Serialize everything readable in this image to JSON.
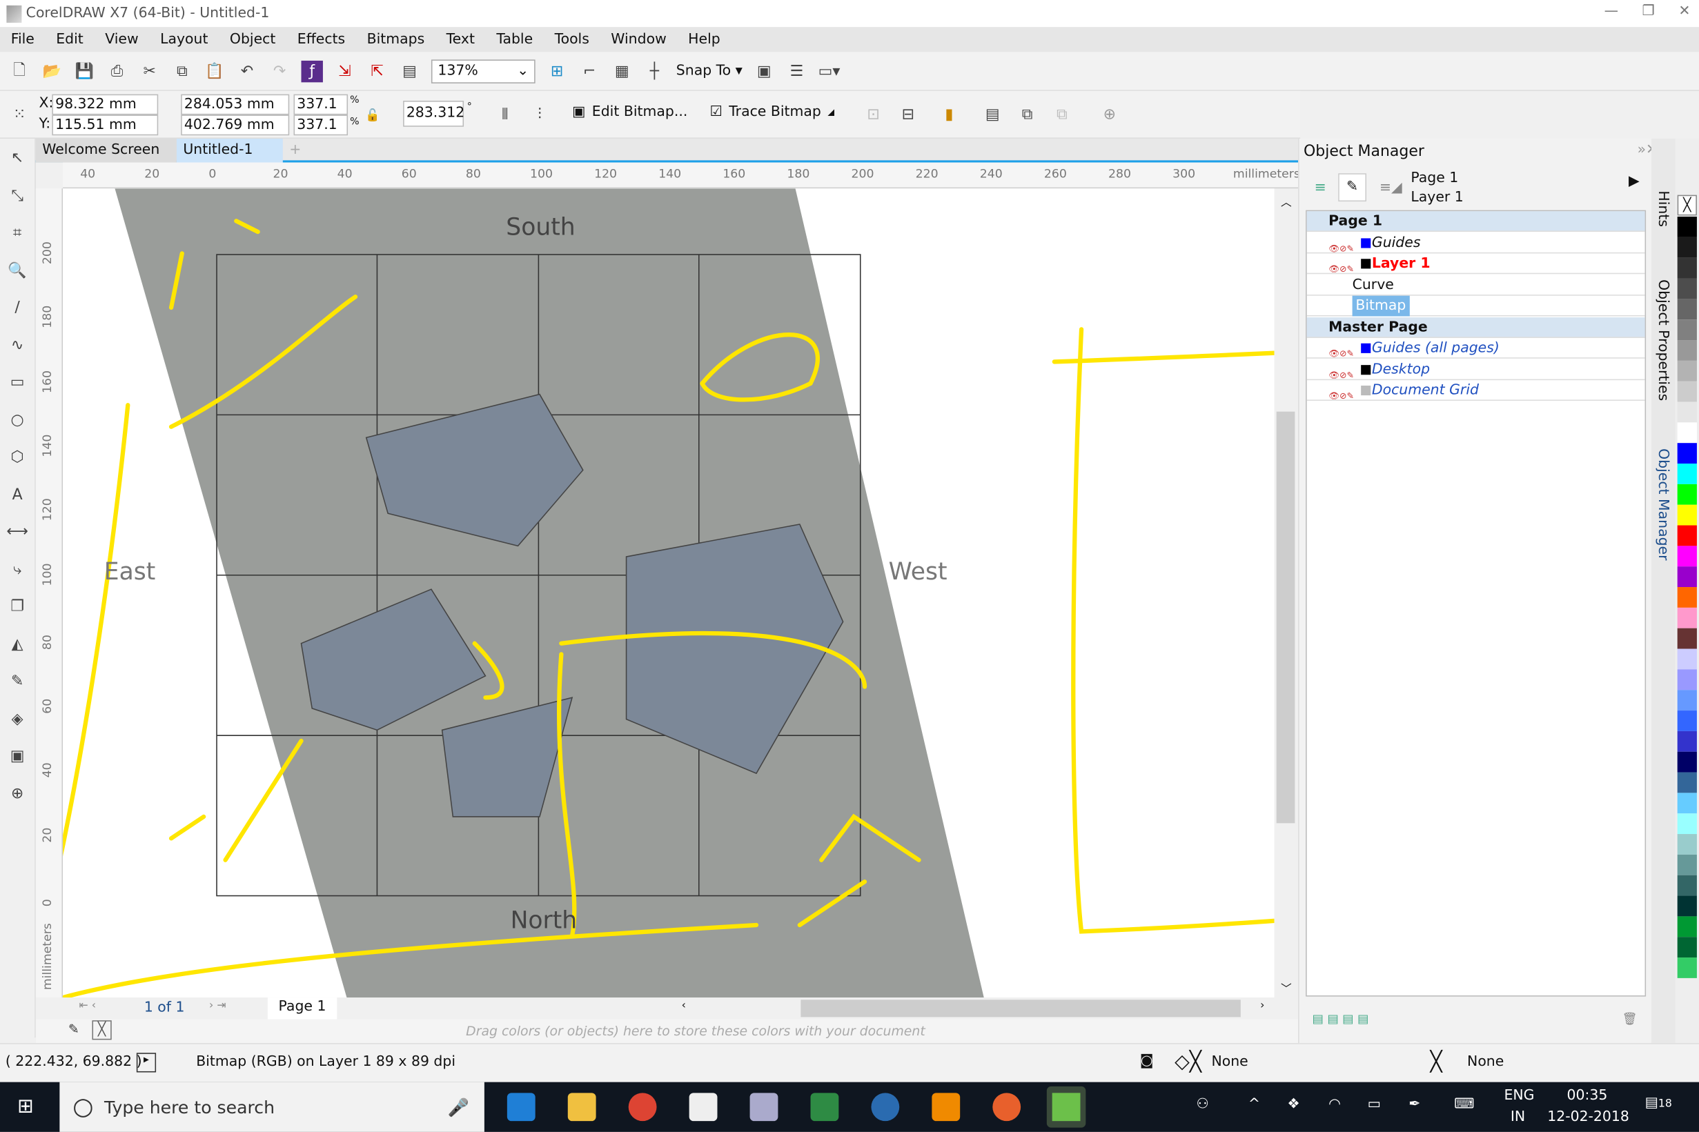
{
  "window": {
    "title": "CorelDRAW X7 (64-Bit) - Untitled-1"
  },
  "menu": [
    "File",
    "Edit",
    "View",
    "Layout",
    "Object",
    "Effects",
    "Bitmaps",
    "Text",
    "Table",
    "Tools",
    "Window",
    "Help"
  ],
  "toolbar": {
    "zoom": "137%",
    "snap_to": "Snap To"
  },
  "propbar": {
    "x": "98.322 mm",
    "y": "115.51 mm",
    "width": "284.053 mm",
    "height": "402.769 mm",
    "scale_x": "337.1",
    "scale_y": "337.1",
    "pct": "%",
    "angle": "283.312",
    "degree": "°",
    "edit_bitmap": "Edit Bitmap...",
    "trace_bitmap": "Trace Bitmap",
    "x_label": "X:",
    "y_label": "Y:"
  },
  "tabs": [
    "Welcome Screen",
    "Untitled-1"
  ],
  "ruler": {
    "h_ticks": [
      "40",
      "20",
      "0",
      "20",
      "40",
      "60",
      "80",
      "100",
      "120",
      "140",
      "160",
      "180",
      "200",
      "220",
      "240",
      "260",
      "280",
      "300"
    ],
    "h_unit": "millimeters",
    "v_ticks": [
      "200",
      "180",
      "160",
      "140",
      "120",
      "100",
      "80",
      "60",
      "40",
      "20",
      "0"
    ],
    "v_unit": "millimeters"
  },
  "canvas": {
    "labels": {
      "south": "South",
      "east": "East",
      "west": "West",
      "north": "North"
    }
  },
  "nav": {
    "page_count": "1 of 1",
    "page_tab": "Page 1"
  },
  "palette_hint": "Drag colors (or objects) here to store these colors with your document",
  "status": {
    "coords": "( 222.432, 69.882 )",
    "info": "Bitmap (RGB) on Layer 1 89 x 89 dpi",
    "fill": "None",
    "outline": "None"
  },
  "object_manager": {
    "title": "Object Manager",
    "page": "Page 1",
    "layer": "Layer 1",
    "tree": [
      {
        "label": "Page 1",
        "type": "page"
      },
      {
        "label": "Guides",
        "type": "layer",
        "color": "#0000ff"
      },
      {
        "label": "Layer 1",
        "type": "layer-active",
        "color": "#000000"
      },
      {
        "label": "Curve",
        "type": "object"
      },
      {
        "label": "Bitmap",
        "type": "object-selected"
      },
      {
        "label": "Master Page",
        "type": "page"
      },
      {
        "label": "Guides (all pages)",
        "type": "master",
        "color": "#0000ff"
      },
      {
        "label": "Desktop",
        "type": "master",
        "color": "#000000"
      },
      {
        "label": "Document Grid",
        "type": "master",
        "color": "#bbbbbb"
      }
    ]
  },
  "side_tabs": [
    "Hints",
    "Object Properties",
    "Object Manager"
  ],
  "palette_colors": [
    "#000000",
    "#1a1a1a",
    "#333333",
    "#4d4d4d",
    "#666666",
    "#808080",
    "#999999",
    "#b3b3b3",
    "#cccccc",
    "#e6e6e6",
    "#ffffff",
    "#0000ff",
    "#00ffff",
    "#00ff00",
    "#ffff00",
    "#ff0000",
    "#ff00ff",
    "#9900cc",
    "#ff6600",
    "#ff99cc",
    "#663333",
    "#ccccff",
    "#9999ff",
    "#6699ff",
    "#3366ff",
    "#3333cc",
    "#000066",
    "#336699",
    "#66ccff",
    "#99ffff",
    "#99cccc",
    "#669999",
    "#336666",
    "#003333",
    "#009933",
    "#006633",
    "#33cc66"
  ],
  "taskbar": {
    "search_placeholder": "Type here to search",
    "lang": "ENG",
    "region": "IN",
    "time": "00:35",
    "date": "12-02-2018",
    "notifications": "18"
  }
}
